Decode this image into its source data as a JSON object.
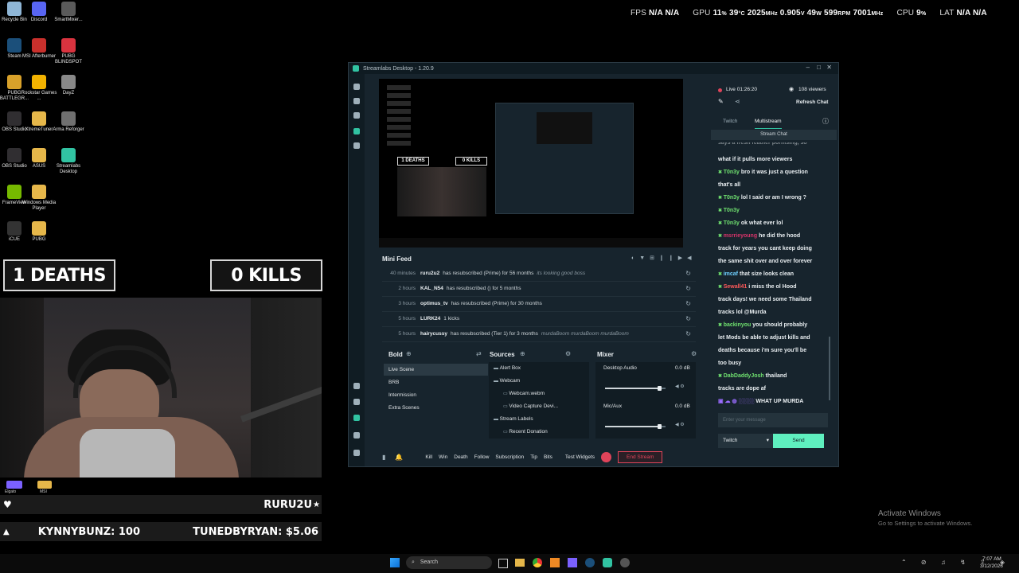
{
  "hud": {
    "fps_label": "FPS",
    "fps_val1": "N/A",
    "fps_val2": "N/A",
    "gpu_label": "GPU",
    "gpu_pct": "11",
    "gpu_pct_unit": "%",
    "gpu_temp": "39",
    "gpu_temp_unit": "°C",
    "gpu_clock": "2025",
    "gpu_clock_unit": "MHz",
    "gpu_volt": "0.905",
    "gpu_volt_unit": "V",
    "gpu_watt": "49",
    "gpu_watt_unit": "W",
    "gpu_rpm": "599",
    "gpu_rpm_unit": "RPM",
    "gpu_mem": "7001",
    "gpu_mem_unit": "MHz",
    "cpu_label": "CPU",
    "cpu_pct": "9",
    "cpu_pct_unit": "%",
    "lat_label": "LAT",
    "lat_val1": "N/A",
    "lat_val2": "N/A"
  },
  "desktop_icons": [
    {
      "label": "Recycle Bin",
      "color": "#8fb6d6"
    },
    {
      "label": "Discord",
      "color": "#5865f2"
    },
    {
      "label": "SmartMixer...",
      "color": "#5a5a5a"
    },
    {
      "label": "Steam",
      "color": "#1b4f7a"
    },
    {
      "label": "MSI Afterburner",
      "color": "#c9302c"
    },
    {
      "label": "PUBG BLINDSPOT",
      "color": "#d9333f"
    },
    {
      "label": "PUBG BATTLEGR...",
      "color": "#d8a12a"
    },
    {
      "label": "Rockstar Games ...",
      "color": "#f2b200"
    },
    {
      "label": "DayZ",
      "color": "#888888"
    },
    {
      "label": "OBS Studio",
      "color": "#302e31"
    },
    {
      "label": "XtremeTuner",
      "color": "#e6b74a"
    },
    {
      "label": "Arma Reforger",
      "color": "#707070"
    },
    {
      "label": "OBS Studio",
      "color": "#302e31"
    },
    {
      "label": "ASUS",
      "color": "#e6b74a"
    },
    {
      "label": "Streamlabs Desktop",
      "color": "#31c3a2"
    },
    {
      "label": "FrameView",
      "color": "#76b900"
    },
    {
      "label": "Windows Media Player",
      "color": "#e6b74a"
    },
    {
      "label": "iCUE",
      "color": "#333333"
    },
    {
      "label": "PUBG",
      "color": "#e6b74a"
    }
  ],
  "overlay": {
    "deaths": "1 DEATHS",
    "kills": "0 KILLS",
    "follower": "RURU2U",
    "sub_left": "KYNNYBUNZ: 100",
    "sub_right": "TUNEDBYRYAN: $5.06",
    "small_icon_1": "Elgato",
    "small_icon_2": "MSI"
  },
  "app": {
    "title": "Streamlabs Desktop - 1.20.9",
    "preview_deaths": "1 DEATHS",
    "preview_kills": "0 KILLS",
    "mini_feed_title": "Mini Feed",
    "feed": [
      {
        "time": "40 minutes",
        "user": "ruru2u2",
        "desc": "has resubscribed (Prime) for 56 months",
        "msg": "its looking good boss"
      },
      {
        "time": "2 hours",
        "user": "KAL_N54",
        "desc": "has resubscribed () for 5 months",
        "msg": ""
      },
      {
        "time": "3 hours",
        "user": "optimus_tv",
        "desc": "has resubscribed (Prime) for 30 months",
        "msg": ""
      },
      {
        "time": "5 hours",
        "user": "LURK24",
        "desc": "1 kicks",
        "msg": ""
      },
      {
        "time": "5 hours",
        "user": "hairycussy",
        "desc": "has resubscribed (Tier 1) for 3 months",
        "msg": "murdaBoom murdaBoom murdaBoom"
      }
    ],
    "scenes_title": "Bold",
    "scenes": [
      "Live Scene",
      "BRB",
      "Intermission",
      "Extra Scenes"
    ],
    "sources_title": "Sources",
    "sources": [
      "Alert Box",
      "Webcam",
      "Webcam.webm",
      "Video Capture Devi...",
      "Stream Labels",
      "Recent Donation"
    ],
    "mixer_title": "Mixer",
    "mixer": [
      {
        "name": "Desktop Audio",
        "db": "0.0 dB",
        "level": 0.9
      },
      {
        "name": "Mic/Aux",
        "db": "0.0 dB",
        "level": 0.9
      }
    ],
    "bottom_buttons": [
      "Kill",
      "Win",
      "Death",
      "Follow",
      "Subscription",
      "Tip",
      "Bits"
    ],
    "test_widgets": "Test Widgets",
    "end_stream": "End Stream"
  },
  "chat": {
    "live": "Live 01:26:20",
    "viewers": "108 viewers",
    "refresh": "Refresh Chat",
    "tab1": "Twitch",
    "tab2": "Multistream",
    "stream_chat": "Stream Chat",
    "partial_top": "says a fresh feather pormsing, so",
    "lines": [
      {
        "user": "",
        "text": "what if it pulls more viewers",
        "color": "#e9eef1"
      },
      {
        "user": "T0n3y",
        "text": "bro it was just a question",
        "color": "#6fe06f"
      },
      {
        "user": "",
        "text": "that's all",
        "color": "#e9eef1"
      },
      {
        "user": "T0n3y",
        "text": "lol I said or am I wrong ?",
        "color": "#6fe06f"
      },
      {
        "user": "T0n3y",
        "text": "",
        "color": "#6fe06f"
      },
      {
        "user": "T0n3y",
        "text": "ok what ever lol",
        "color": "#6fe06f"
      },
      {
        "user": "msrrieyoung",
        "text": "he did the hood",
        "color": "#d9346a"
      },
      {
        "user": "",
        "text": "track for years you cant keep doing",
        "color": "#e9eef1"
      },
      {
        "user": "",
        "text": "the same shit over and over forever",
        "color": "#e9eef1"
      },
      {
        "user": "imcaf",
        "text": "that size looks clean",
        "color": "#6fd0ff"
      },
      {
        "user": "Sewall41",
        "text": "i miss the ol Hood",
        "color": "#ff5a5a"
      },
      {
        "user": "",
        "text": "track days! we need some Thailand",
        "color": "#e9eef1"
      },
      {
        "user": "",
        "text": "tracks lol @Murda",
        "color": "#e9eef1"
      },
      {
        "user": "backinyou",
        "text": "you should probably",
        "color": "#6fe06f"
      },
      {
        "user": "",
        "text": "let Mods be able to adjust kills and",
        "color": "#e9eef1"
      },
      {
        "user": "",
        "text": "deaths because i'm sure you'll be",
        "color": "#e9eef1"
      },
      {
        "user": "",
        "text": "too busy",
        "color": "#e9eef1"
      },
      {
        "user": "DabDaddyJosh",
        "text": "thailand",
        "color": "#6fe06f"
      },
      {
        "user": "",
        "text": "tracks are dope af",
        "color": "#e9eef1"
      },
      {
        "user": "",
        "text": "WHAT UP MURDA",
        "color": "#e9eef1"
      }
    ],
    "input_placeholder": "Enter your message",
    "platform": "Twitch",
    "send": "Send"
  },
  "watermark": {
    "line1": "Activate Windows",
    "line2": "Go to Settings to activate Windows."
  },
  "taskbar": {
    "search": "Search",
    "time": "7:07 AM",
    "date": "3/12/2026"
  },
  "colors": {
    "accent": "#31c3a2",
    "end_stream": "#e0445a",
    "app_bg": "#17242d"
  }
}
